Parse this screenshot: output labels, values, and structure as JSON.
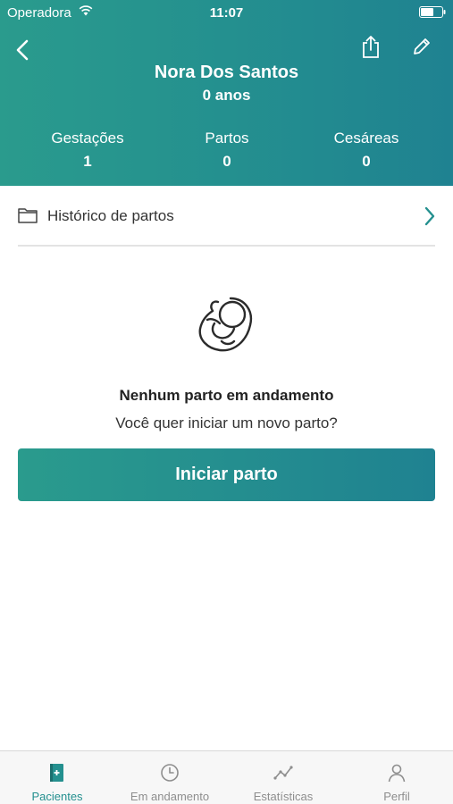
{
  "status_bar": {
    "carrier": "Operadora",
    "time": "11:07"
  },
  "header": {
    "patient_name": "Nora Dos Santos",
    "age": "0 anos",
    "stats": [
      {
        "label": "Gestações",
        "value": "1"
      },
      {
        "label": "Partos",
        "value": "0"
      },
      {
        "label": "Cesáreas",
        "value": "0"
      }
    ]
  },
  "history": {
    "label": "Histórico de partos"
  },
  "empty_state": {
    "title": "Nenhum parto em andamento",
    "subtitle": "Você quer iniciar um novo parto?",
    "button_label": "Iniciar parto"
  },
  "tabs": [
    {
      "label": "Pacientes",
      "icon": "patients-book-icon",
      "active": true
    },
    {
      "label": "Em andamento",
      "icon": "clock-icon",
      "active": false
    },
    {
      "label": "Estatísticas",
      "icon": "stats-line-icon",
      "active": false
    },
    {
      "label": "Perfil",
      "icon": "person-icon",
      "active": false
    }
  ],
  "colors": {
    "primary": "#24908f",
    "primary_light": "#2a9b8d",
    "tab_inactive": "#8e8e8e"
  }
}
